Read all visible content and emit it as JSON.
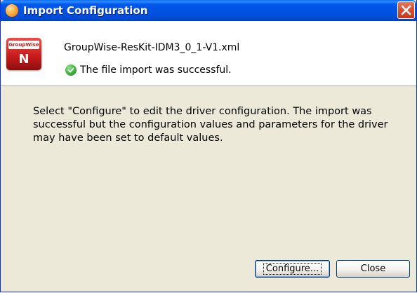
{
  "window": {
    "title": "Import Configuration"
  },
  "header": {
    "logo_text": "GroupWise",
    "logo_letter": "N",
    "file_name": "GroupWise-ResKit-IDM3_0_1-V1.xml",
    "status_text": "The file import was successful."
  },
  "body": {
    "message": "Select \"Configure\" to edit the driver configuration.  The import was successful but the configuration values and parameters for the driver may have been set to default values."
  },
  "buttons": {
    "configure_label": "Configure...",
    "close_label": "Close"
  },
  "colors": {
    "titlebar": "#0054e3",
    "close_button": "#d8553a",
    "dialog_background": "#ece9d8",
    "success_icon": "#3fb03b",
    "logo_red": "#c81d1c"
  },
  "icons": {
    "title_icon": "app-icon",
    "close_icon": "close-icon",
    "logo": "groupwise-logo",
    "status_icon": "checkmark-icon"
  }
}
